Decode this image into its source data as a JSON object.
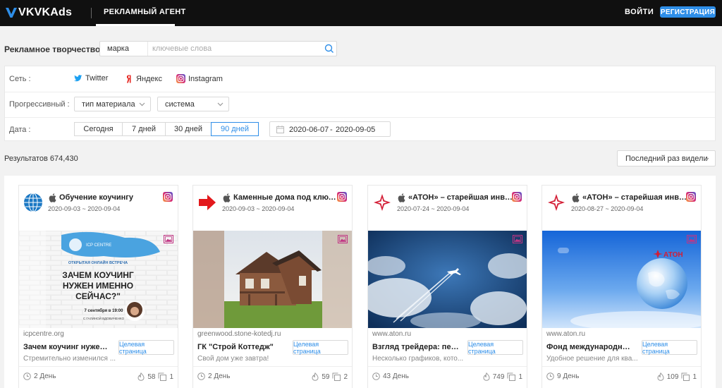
{
  "header": {
    "logo": "VKVKAds",
    "nav_tab": "РЕКЛАМНЫЙ АГЕНТ",
    "login": "ВОЙТИ",
    "register": "РЕГИСТРАЦИЯ"
  },
  "search": {
    "label": "Рекламное творчество",
    "brand_select": "марка",
    "placeholder": "ключевые слова"
  },
  "filters": {
    "network_label": "Сеть :",
    "networks": [
      "Twitter",
      "Яндекс",
      "Instagram"
    ],
    "progressive_label": "Прогрессивный :",
    "material_select": "тип материала",
    "system_select": "система",
    "date_label": "Дата :",
    "date_buttons": [
      "Сегодня",
      "7 дней",
      "30 дней",
      "90 дней"
    ],
    "active_date": "90 дней",
    "range_start": "2020-06-07",
    "range_sep": "-",
    "range_end": "2020-09-05"
  },
  "results": {
    "label": "Результатов 674,430",
    "sort": "Последний раз видели"
  },
  "cards": [
    {
      "title": "Обучение коучингу",
      "date": "2020-09-03 ~ 2020-09-04",
      "domain": "icpcentre.org",
      "headline": "Зачем коучинг нужен и...",
      "button": "Целевая страница",
      "desc": "Стремительно изменился ...",
      "days": "2 День",
      "likes": "58",
      "count": "1",
      "img_lines": [
        "ОТКРЫТАЯ ОНЛАЙН ВСТРЕЧА",
        "ЗАЧЕМ КОУЧИНГ",
        "НУЖЕН ИМЕННО",
        "СЕЙЧАС?\"",
        "7 сентября в 19:00",
        "С ГАЛИНОЙ ВДОВИЧЕНКО",
        "ICP CENTRE"
      ]
    },
    {
      "title": "Каменные дома под ключ. ...",
      "date": "2020-09-03 ~ 2020-09-04",
      "domain": "greenwood.stone-kotedj.ru",
      "headline": "ГК \"Строй Коттедж\"",
      "button": "Целевая страница",
      "desc": "Свой дом уже завтра!",
      "days": "2 День",
      "likes": "59",
      "count": "2"
    },
    {
      "title": "«АТОН» – старейшая инвес...",
      "date": "2020-07-24 ~ 2020-09-04",
      "domain": "www.aton.ru",
      "headline": "Взгляд трейдера: переиз...",
      "button": "Целевая страница",
      "desc": "Несколько графиков, кото...",
      "days": "43 День",
      "likes": "749",
      "count": "1"
    },
    {
      "title": "«АТОН» – старейшая инвес...",
      "date": "2020-08-27 ~ 2020-09-04",
      "domain": "www.aton.ru",
      "headline": "Фонд международных IP...",
      "button": "Целевая страница",
      "desc": "Удобное решение для ква...",
      "days": "9 День",
      "likes": "109",
      "count": "1",
      "img_logo": "АТОН"
    }
  ],
  "colors": {
    "accent": "#2e8ee8",
    "topbar": "#101010",
    "instagram": "#c13584"
  }
}
